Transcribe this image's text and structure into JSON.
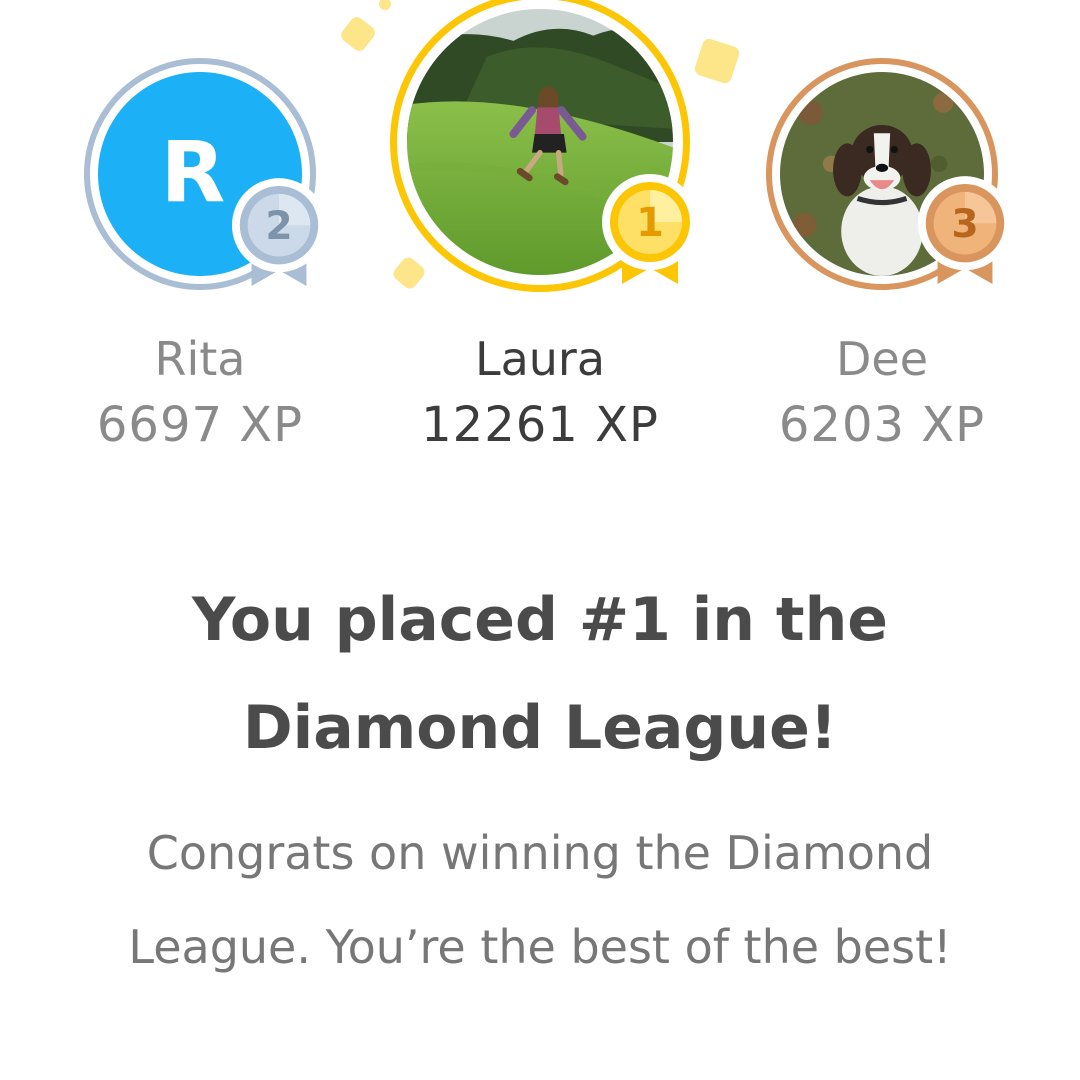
{
  "colors": {
    "gold": "#fcc605",
    "silver": "#a9bdd4",
    "bronze": "#d9955e",
    "rita_avatar_bg": "#1cb0f6",
    "headline": "#4b4b4b",
    "body_text": "#777777"
  },
  "podium": [
    {
      "rank": "2",
      "name": "Rita",
      "xp": "6697 XP",
      "avatar_initial": "R",
      "medal": "silver-medal-icon"
    },
    {
      "rank": "1",
      "name": "Laura",
      "xp": "12261 XP",
      "avatar": "photo-person-in-field",
      "medal": "gold-medal-icon"
    },
    {
      "rank": "3",
      "name": "Dee",
      "xp": "6203 XP",
      "avatar": "photo-spaniel-dog",
      "medal": "bronze-medal-icon"
    }
  ],
  "headline": "You placed #1 in the Diamond League!",
  "message": "Congrats on winning the Diamond League. You’re the best of the best!"
}
